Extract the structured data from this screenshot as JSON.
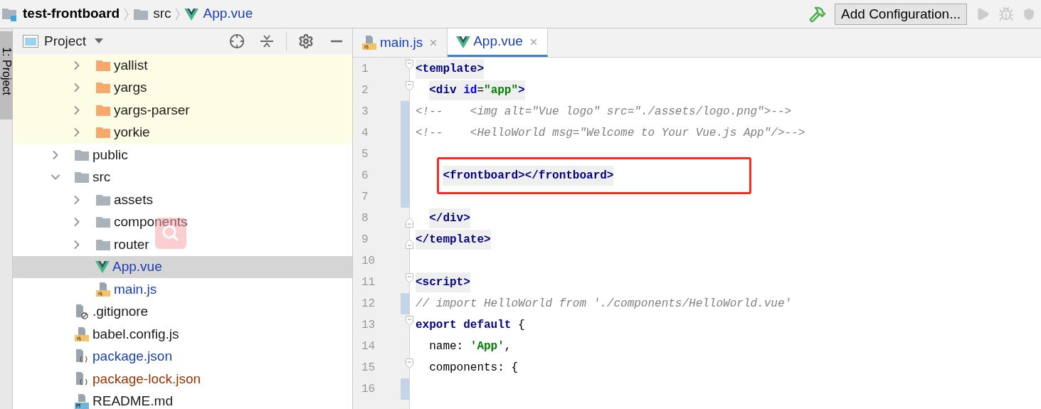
{
  "breadcrumb": [
    {
      "kind": "project",
      "label": "test-frontboard"
    },
    {
      "kind": "folder",
      "label": "src"
    },
    {
      "kind": "vue",
      "label": "App.vue"
    }
  ],
  "toolbar": {
    "config_button": "Add Configuration..."
  },
  "side_strip": {
    "tab": "1: Project"
  },
  "project_panel": {
    "title": "Project",
    "tree": [
      {
        "children": [
          {
            "name": "yallist",
            "kind": "folder",
            "library": true,
            "expanded": false,
            "selected": false,
            "modified": false,
            "unversioned": false
          },
          {
            "name": "yargs",
            "kind": "folder",
            "library": true,
            "expanded": false,
            "selected": false,
            "modified": false,
            "unversioned": false
          },
          {
            "name": "yargs-parser",
            "kind": "folder",
            "library": true,
            "expanded": false,
            "selected": false,
            "modified": false,
            "unversioned": false
          },
          {
            "name": "yorkie",
            "kind": "folder",
            "library": true,
            "expanded": false,
            "selected": false,
            "modified": false,
            "unversioned": false
          }
        ]
      },
      {
        "name": "public",
        "kind": "folder",
        "library": false,
        "expanded": false,
        "selected": false,
        "modified": false,
        "unversioned": false
      },
      {
        "name": "src",
        "kind": "folder",
        "library": false,
        "expanded": true,
        "selected": false,
        "modified": false,
        "unversioned": false,
        "children": [
          {
            "name": "assets",
            "kind": "folder",
            "library": false,
            "expanded": false,
            "selected": false,
            "modified": false,
            "unversioned": false
          },
          {
            "name": "components",
            "kind": "folder",
            "library": false,
            "expanded": false,
            "selected": false,
            "modified": false,
            "unversioned": false
          },
          {
            "name": "router",
            "kind": "folder",
            "library": false,
            "expanded": false,
            "selected": false,
            "modified": false,
            "unversioned": false
          },
          {
            "name": "App.vue",
            "kind": "vue",
            "library": false,
            "selected": true,
            "modified": true,
            "unversioned": false
          },
          {
            "name": "main.js",
            "kind": "js",
            "library": false,
            "selected": false,
            "modified": true,
            "unversioned": false
          }
        ]
      },
      {
        "name": ".gitignore",
        "kind": "ignore",
        "library": false,
        "selected": false,
        "modified": false,
        "unversioned": false
      },
      {
        "name": "babel.config.js",
        "kind": "js",
        "library": false,
        "selected": false,
        "modified": false,
        "unversioned": false
      },
      {
        "name": "package.json",
        "kind": "json",
        "library": false,
        "selected": false,
        "modified": true,
        "unversioned": false
      },
      {
        "name": "package-lock.json",
        "kind": "json",
        "library": false,
        "selected": false,
        "modified": false,
        "unversioned": true
      },
      {
        "name": "README.md",
        "kind": "md",
        "library": false,
        "selected": false,
        "modified": false,
        "unversioned": false
      }
    ]
  },
  "editor": {
    "tabs": [
      {
        "label": "main.js",
        "kind": "js",
        "selected": false
      },
      {
        "label": "App.vue",
        "kind": "vue",
        "selected": true
      }
    ],
    "lines": [
      {
        "number": "1",
        "fold_start": true,
        "fold_end": false,
        "changed": false,
        "highlighted": true,
        "boxed": false,
        "tokens": [
          {
            "kind": "tag",
            "text": "<template>"
          }
        ]
      },
      {
        "number": "2",
        "fold_start": true,
        "fold_end": false,
        "changed": false,
        "highlighted": true,
        "boxed": false,
        "tokens": [
          {
            "kind": "tag",
            "text": "  <div"
          },
          {
            "kind": "attr",
            "text": " id"
          },
          {
            "kind": "plain",
            "text": "="
          },
          {
            "kind": "string",
            "text": "\"app\""
          },
          {
            "kind": "tag",
            "text": ">"
          }
        ]
      },
      {
        "number": "3",
        "fold_start": false,
        "fold_end": false,
        "changed": true,
        "highlighted": false,
        "boxed": false,
        "tokens": [
          {
            "kind": "comment",
            "text": "<!--    <img alt=\"Vue logo\" src=\"./assets/logo.png\">-->"
          }
        ]
      },
      {
        "number": "4",
        "fold_start": false,
        "fold_end": false,
        "changed": true,
        "highlighted": false,
        "boxed": false,
        "tokens": [
          {
            "kind": "comment",
            "text": "<!--    <HelloWorld msg=\"Welcome to Your Vue.js App\"/>-->"
          }
        ]
      },
      {
        "number": "5",
        "fold_start": false,
        "fold_end": false,
        "changed": true,
        "boxed": false
      },
      {
        "number": "6",
        "fold_start": false,
        "fold_end": false,
        "changed": true,
        "highlighted": true,
        "boxed": true,
        "tokens": [
          {
            "kind": "tag",
            "text": "    <frontboard></frontboard>"
          }
        ]
      },
      {
        "number": "7",
        "fold_start": false,
        "fold_end": false,
        "changed": true,
        "boxed": false
      },
      {
        "number": "8",
        "fold_start": false,
        "fold_end": true,
        "changed": false,
        "highlighted": true,
        "boxed": false,
        "tokens": [
          {
            "kind": "tag",
            "text": "  </div>"
          }
        ]
      },
      {
        "number": "9",
        "fold_start": false,
        "fold_end": true,
        "changed": false,
        "highlighted": true,
        "boxed": false,
        "tokens": [
          {
            "kind": "tag",
            "text": "</template>"
          }
        ]
      },
      {
        "number": "10",
        "fold_start": false,
        "fold_end": false,
        "changed": false,
        "boxed": false
      },
      {
        "number": "11",
        "fold_start": true,
        "fold_end": false,
        "changed": false,
        "highlighted": true,
        "boxed": false,
        "tokens": [
          {
            "kind": "tag",
            "text": "<script>"
          }
        ]
      },
      {
        "number": "12",
        "fold_start": false,
        "fold_end": false,
        "changed": true,
        "highlighted": false,
        "boxed": false,
        "tokens": [
          {
            "kind": "comment",
            "text": "// import HelloWorld from './components/HelloWorld.vue'"
          }
        ]
      },
      {
        "number": "13",
        "fold_start": true,
        "fold_end": false,
        "changed": false,
        "highlighted": false,
        "boxed": false,
        "tokens": [
          {
            "kind": "keyword",
            "text": "export default"
          },
          {
            "kind": "plain",
            "text": " {"
          }
        ]
      },
      {
        "number": "14",
        "fold_start": false,
        "fold_end": false,
        "changed": false,
        "highlighted": false,
        "boxed": false,
        "tokens": [
          {
            "kind": "plain",
            "text": "  name: "
          },
          {
            "kind": "string",
            "text": "'App'"
          },
          {
            "kind": "plain",
            "text": ","
          }
        ]
      },
      {
        "number": "15",
        "fold_start": true,
        "fold_end": false,
        "changed": false,
        "highlighted": false,
        "boxed": false,
        "tokens": [
          {
            "kind": "plain",
            "text": "  components: {"
          }
        ]
      },
      {
        "number": "16",
        "fold_start": false,
        "fold_end": false,
        "changed": true,
        "boxed": false
      }
    ]
  }
}
